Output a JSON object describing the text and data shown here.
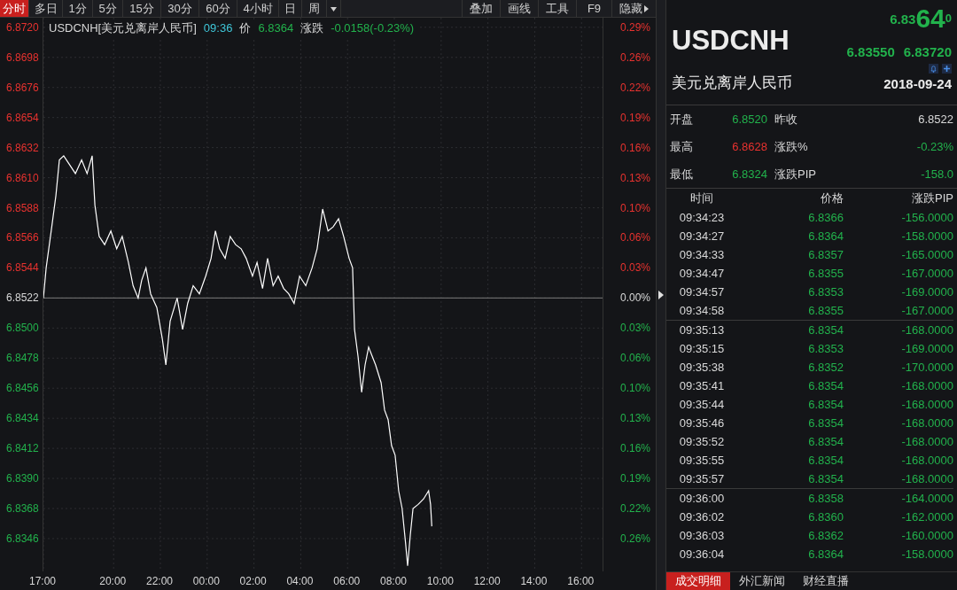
{
  "toolbar": {
    "tabs": [
      {
        "label": "分时",
        "selected": true
      },
      {
        "label": "多日",
        "selected": false
      },
      {
        "label": "1分",
        "selected": false
      },
      {
        "label": "5分",
        "selected": false
      },
      {
        "label": "15分",
        "selected": false
      },
      {
        "label": "30分",
        "selected": false
      },
      {
        "label": "60分",
        "selected": false
      },
      {
        "label": "4小时",
        "selected": false
      },
      {
        "label": "日",
        "selected": false
      },
      {
        "label": "周",
        "selected": false
      }
    ],
    "tools": [
      {
        "label": "叠加"
      },
      {
        "label": "画线"
      },
      {
        "label": "工具"
      },
      {
        "label": "F9"
      },
      {
        "label": "隐藏"
      }
    ]
  },
  "chart_header": {
    "symbol": "USDCNH[美元兑离岸人民币]",
    "time": "09:36",
    "price_label": "价",
    "price": "6.8364",
    "change_label": "涨跌",
    "change": "-0.0158(-0.23%)"
  },
  "pct_labels": [
    {
      "text": "0.29%",
      "kind": "up"
    },
    {
      "text": "0.26%",
      "kind": "up"
    },
    {
      "text": "0.22%",
      "kind": "up"
    },
    {
      "text": "0.19%",
      "kind": "up"
    },
    {
      "text": "0.16%",
      "kind": "up"
    },
    {
      "text": "0.13%",
      "kind": "up"
    },
    {
      "text": "0.10%",
      "kind": "up"
    },
    {
      "text": "0.06%",
      "kind": "up"
    },
    {
      "text": "0.03%",
      "kind": "up"
    },
    {
      "text": "0.00%",
      "kind": "flat"
    },
    {
      "text": "0.03%",
      "kind": "down"
    },
    {
      "text": "0.06%",
      "kind": "down"
    },
    {
      "text": "0.10%",
      "kind": "down"
    },
    {
      "text": "0.13%",
      "kind": "down"
    },
    {
      "text": "0.16%",
      "kind": "down"
    },
    {
      "text": "0.19%",
      "kind": "down"
    },
    {
      "text": "0.22%",
      "kind": "down"
    },
    {
      "text": "0.26%",
      "kind": "down"
    }
  ],
  "chart_data": {
    "type": "line",
    "grid": true,
    "ref_lines": [
      {
        "axis": "y",
        "value": 6.8522,
        "color": "#7a7a7a"
      }
    ],
    "xlim": [
      "2018-09-23T17:00",
      "2018-09-24T16:54"
    ],
    "ylim": [
      6.8322,
      6.8727
    ],
    "xticks": [
      {
        "value": "2018-09-23T17:00",
        "label": "17:00"
      },
      {
        "value": "2018-09-23T20:00",
        "label": "20:00"
      },
      {
        "value": "2018-09-23T22:00",
        "label": "22:00"
      },
      {
        "value": "2018-09-24T00:00",
        "label": "00:00"
      },
      {
        "value": "2018-09-24T02:00",
        "label": "02:00"
      },
      {
        "value": "2018-09-24T04:00",
        "label": "04:00"
      },
      {
        "value": "2018-09-24T06:00",
        "label": "06:00"
      },
      {
        "value": "2018-09-24T08:00",
        "label": "08:00"
      },
      {
        "value": "2018-09-24T10:00",
        "label": "10:00"
      },
      {
        "value": "2018-09-24T12:00",
        "label": "12:00"
      },
      {
        "value": "2018-09-24T14:00",
        "label": "14:00"
      },
      {
        "value": "2018-09-24T16:00",
        "label": "16:00"
      }
    ],
    "yticks": [
      {
        "value": 6.872,
        "label": "6.8720"
      },
      {
        "value": 6.8698,
        "label": "6.8698"
      },
      {
        "value": 6.8676,
        "label": "6.8676"
      },
      {
        "value": 6.8654,
        "label": "6.8654"
      },
      {
        "value": 6.8632,
        "label": "6.8632"
      },
      {
        "value": 6.861,
        "label": "6.8610"
      },
      {
        "value": 6.8588,
        "label": "6.8588"
      },
      {
        "value": 6.8566,
        "label": "6.8566"
      },
      {
        "value": 6.8544,
        "label": "6.8544"
      },
      {
        "value": 6.8522,
        "label": "6.8522"
      },
      {
        "value": 6.85,
        "label": "6.8500"
      },
      {
        "value": 6.8478,
        "label": "6.8478"
      },
      {
        "value": 6.8456,
        "label": "6.8456"
      },
      {
        "value": 6.8434,
        "label": "6.8434"
      },
      {
        "value": 6.8412,
        "label": "6.8412"
      },
      {
        "value": 6.839,
        "label": "6.8390"
      },
      {
        "value": 6.8368,
        "label": "6.8368"
      },
      {
        "value": 6.8346,
        "label": "6.8346"
      }
    ],
    "x": [
      "2018-09-23T17:00",
      "2018-09-23T17:07",
      "2018-09-23T17:20",
      "2018-09-23T17:32",
      "2018-09-23T17:41",
      "2018-09-23T17:52",
      "2018-09-23T18:06",
      "2018-09-23T18:22",
      "2018-09-23T18:38",
      "2018-09-23T18:52",
      "2018-09-23T19:05",
      "2018-09-23T19:12",
      "2018-09-23T19:23",
      "2018-09-23T19:37",
      "2018-09-23T19:53",
      "2018-09-23T20:08",
      "2018-09-23T20:22",
      "2018-09-23T20:38",
      "2018-09-23T20:50",
      "2018-09-23T21:03",
      "2018-09-23T21:12",
      "2018-09-23T21:23",
      "2018-09-23T21:35",
      "2018-09-23T21:51",
      "2018-09-23T22:05",
      "2018-09-23T22:14",
      "2018-09-23T22:25",
      "2018-09-23T22:43",
      "2018-09-23T22:57",
      "2018-09-23T23:10",
      "2018-09-23T23:24",
      "2018-09-23T23:40",
      "2018-09-23T23:56",
      "2018-09-24T00:10",
      "2018-09-24T00:21",
      "2018-09-24T00:32",
      "2018-09-24T00:46",
      "2018-09-24T00:59",
      "2018-09-24T01:13",
      "2018-09-24T01:27",
      "2018-09-24T01:40",
      "2018-09-24T01:56",
      "2018-09-24T02:08",
      "2018-09-24T02:22",
      "2018-09-24T02:35",
      "2018-09-24T02:49",
      "2018-09-24T03:02",
      "2018-09-24T03:16",
      "2018-09-24T03:29",
      "2018-09-24T03:43",
      "2018-09-24T03:57",
      "2018-09-24T04:13",
      "2018-09-24T04:29",
      "2018-09-24T04:42",
      "2018-09-24T04:56",
      "2018-09-24T05:10",
      "2018-09-24T05:23",
      "2018-09-24T05:37",
      "2018-09-24T05:50",
      "2018-09-24T06:04",
      "2018-09-24T06:13",
      "2018-09-24T06:18",
      "2018-09-24T06:27",
      "2018-09-24T06:36",
      "2018-09-24T06:45",
      "2018-09-24T06:54",
      "2018-09-24T07:12",
      "2018-09-24T07:26",
      "2018-09-24T07:35",
      "2018-09-24T07:44",
      "2018-09-24T07:53",
      "2018-09-24T08:02",
      "2018-09-24T08:11",
      "2018-09-24T08:20",
      "2018-09-24T08:29",
      "2018-09-24T08:34",
      "2018-09-24T08:41",
      "2018-09-24T08:48",
      "2018-09-24T09:01",
      "2018-09-24T09:15",
      "2018-09-24T09:28",
      "2018-09-24T09:33",
      "2018-09-24T09:36"
    ],
    "series": [
      {
        "color": "#ffffff",
        "values": [
          6.8522,
          6.8544,
          6.8571,
          6.8597,
          6.8623,
          6.8626,
          6.862,
          6.8613,
          6.8623,
          6.8613,
          6.8626,
          6.859,
          6.8567,
          6.8561,
          6.8571,
          6.8558,
          6.8567,
          6.8548,
          6.8531,
          6.8522,
          6.8535,
          6.8544,
          6.8525,
          6.8515,
          6.8492,
          6.8473,
          6.8505,
          6.8522,
          6.8499,
          6.8518,
          6.8531,
          6.8525,
          6.8538,
          6.8551,
          6.8571,
          6.8558,
          6.8551,
          6.8567,
          6.8561,
          6.8558,
          6.8551,
          6.8538,
          6.8548,
          6.8529,
          6.8551,
          6.8531,
          6.8538,
          6.8529,
          6.8525,
          6.8518,
          6.8538,
          6.8531,
          6.8544,
          6.8558,
          6.8587,
          6.8571,
          6.8574,
          6.858,
          6.8567,
          6.8551,
          6.8544,
          6.8499,
          6.8479,
          6.8453,
          6.8473,
          6.8486,
          6.8473,
          6.846,
          6.844,
          6.8433,
          6.8414,
          6.8407,
          6.8381,
          6.8368,
          6.8342,
          6.8326,
          6.8349,
          6.8368,
          6.8371,
          6.8375,
          6.8381,
          6.8371,
          6.8355
        ]
      }
    ]
  },
  "quote": {
    "symbol": "USDCNH",
    "price_main": "6.83",
    "price_big": "64",
    "price_sup": "0",
    "bid": "6.83550",
    "ask": "6.83720",
    "name": "美元兑离岸人民币",
    "date": "2018-09-24"
  },
  "stats": [
    {
      "label": "开盘",
      "value": "6.8520",
      "color": "#22b24c"
    },
    {
      "label": "昨收",
      "value": "6.8522",
      "color": "#d8d8d8"
    },
    {
      "label": "最高",
      "value": "6.8628",
      "color": "#e8322f"
    },
    {
      "label": "涨跌%",
      "value": "-0.23%",
      "color": "#22b24c"
    },
    {
      "label": "最低",
      "value": "6.8324",
      "color": "#22b24c"
    },
    {
      "label": "涨跌PIP",
      "value": "-158.0",
      "color": "#22b24c"
    }
  ],
  "trades": {
    "columns": [
      "时间",
      "价格",
      "涨跌PIP"
    ],
    "groups": [
      {
        "rows": [
          [
            "09:34:23",
            "6.8366",
            "-156.0000"
          ],
          [
            "09:34:27",
            "6.8364",
            "-158.0000"
          ],
          [
            "09:34:33",
            "6.8357",
            "-165.0000"
          ],
          [
            "09:34:47",
            "6.8355",
            "-167.0000"
          ],
          [
            "09:34:57",
            "6.8353",
            "-169.0000"
          ],
          [
            "09:34:58",
            "6.8355",
            "-167.0000"
          ]
        ]
      },
      {
        "rows": [
          [
            "09:35:13",
            "6.8354",
            "-168.0000"
          ],
          [
            "09:35:15",
            "6.8353",
            "-169.0000"
          ],
          [
            "09:35:38",
            "6.8352",
            "-170.0000"
          ],
          [
            "09:35:41",
            "6.8354",
            "-168.0000"
          ],
          [
            "09:35:44",
            "6.8354",
            "-168.0000"
          ],
          [
            "09:35:46",
            "6.8354",
            "-168.0000"
          ],
          [
            "09:35:52",
            "6.8354",
            "-168.0000"
          ],
          [
            "09:35:55",
            "6.8354",
            "-168.0000"
          ],
          [
            "09:35:57",
            "6.8354",
            "-168.0000"
          ]
        ]
      },
      {
        "rows": [
          [
            "09:36:00",
            "6.8358",
            "-164.0000"
          ],
          [
            "09:36:02",
            "6.8360",
            "-162.0000"
          ],
          [
            "09:36:03",
            "6.8362",
            "-160.0000"
          ],
          [
            "09:36:04",
            "6.8364",
            "-158.0000"
          ]
        ]
      }
    ]
  },
  "bottom_tabs": [
    {
      "label": "成交明细",
      "selected": true
    },
    {
      "label": "外汇新闻",
      "selected": false
    },
    {
      "label": "财经直播",
      "selected": false
    }
  ]
}
